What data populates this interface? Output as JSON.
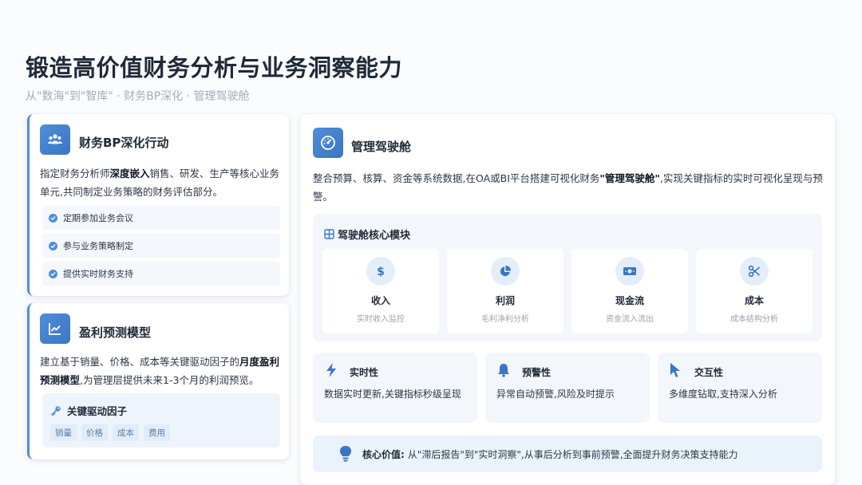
{
  "header": {
    "title": "锻造高价值财务分析与业务洞察能力",
    "subtitle": "从\"数海\"到\"智库\" · 财务BP深化 · 管理驾驶舱"
  },
  "bp_card": {
    "title": "财务BP深化行动",
    "text_1": "指定财务分析师",
    "text_bold": "深度嵌入",
    "text_2": "销售、研发、生产等核心业务单元,共同制定业务策略的财务评估部分。",
    "items": [
      "定期参加业务会议",
      "参与业务策略制定",
      "提供实时财务支持"
    ]
  },
  "profit_card": {
    "title": "盈利预测模型",
    "text_1": "建立基于销量、价格、成本等关键驱动因子的",
    "text_bold": "月度盈利预测模型",
    "text_2": ",为管理层提供未来1-3个月的利润预览。",
    "drivers_title": "关键驱动因子",
    "drivers": [
      "销量",
      "价格",
      "成本",
      "费用"
    ]
  },
  "cockpit_card": {
    "title": "管理驾驶舱",
    "text_1": "整合预算、核算、资金等系统数据,在OA或BI平台搭建可视化财务",
    "text_bold": "\"管理驾驶舱\"",
    "text_2": ",实现关键指标的实时可视化呈现与预警。",
    "modules_title": "驾驶舱核心模块",
    "modules": [
      {
        "name": "收入",
        "desc": "实时收入监控",
        "icon": "dollar-icon"
      },
      {
        "name": "利润",
        "desc": "毛利净利分析",
        "icon": "pie-chart-icon"
      },
      {
        "name": "现金流",
        "desc": "资金流入流出",
        "icon": "money-bill-icon"
      },
      {
        "name": "成本",
        "desc": "成本结构分析",
        "icon": "scissors-icon"
      }
    ],
    "features": [
      {
        "name": "实时性",
        "desc": "数据实时更新,关键指标秒级呈现",
        "icon": "bolt-icon"
      },
      {
        "name": "预警性",
        "desc": "异常自动预警,风险及时提示",
        "icon": "bell-icon"
      },
      {
        "name": "交互性",
        "desc": "多维度钻取,支持深入分析",
        "icon": "pointer-icon"
      }
    ],
    "core_value_label": "核心价值:",
    "core_value_text": "从\"滞后报告\"到\"实时洞察\",从事后分析到事前预警,全面提升财务决策支持能力"
  },
  "colors": {
    "accent": "#4f8ed8",
    "accent_dark": "#3a76c4",
    "panel_bg": "#f3f6fa",
    "muted_text": "#9aa3af"
  }
}
